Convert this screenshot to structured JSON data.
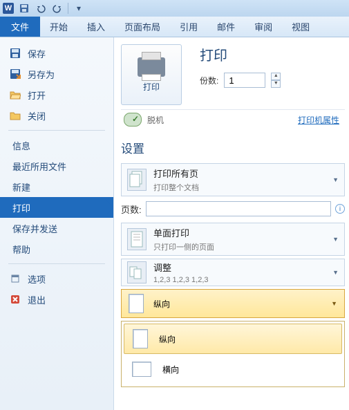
{
  "titlebar": {
    "app_icon": "W"
  },
  "ribbon": {
    "file": "文件",
    "home": "开始",
    "insert": "插入",
    "layout": "页面布局",
    "references": "引用",
    "mail": "邮件",
    "review": "审阅",
    "view": "视图"
  },
  "sidebar": {
    "save": "保存",
    "save_as": "另存为",
    "open": "打开",
    "close": "关闭",
    "info": "信息",
    "recent": "最近所用文件",
    "new": "新建",
    "print": "打印",
    "save_send": "保存并发送",
    "help": "帮助",
    "options": "选项",
    "exit": "退出"
  },
  "print": {
    "title": "打印",
    "button_label": "打印",
    "copies_label": "份数:",
    "copies_value": "1",
    "status": "脱机",
    "printer_properties": "打印机属性",
    "settings_title": "设置",
    "print_all_title": "打印所有页",
    "print_all_sub": "打印整个文档",
    "pages_label": "页数:",
    "pages_value": "",
    "duplex_title": "单面打印",
    "duplex_sub": "只打印一侧的页面",
    "collate_title": "调整",
    "collate_sub": "1,2,3    1,2,3    1,2,3",
    "orientation_selected": "纵向",
    "orientation_portrait": "纵向",
    "orientation_landscape": "横向"
  }
}
